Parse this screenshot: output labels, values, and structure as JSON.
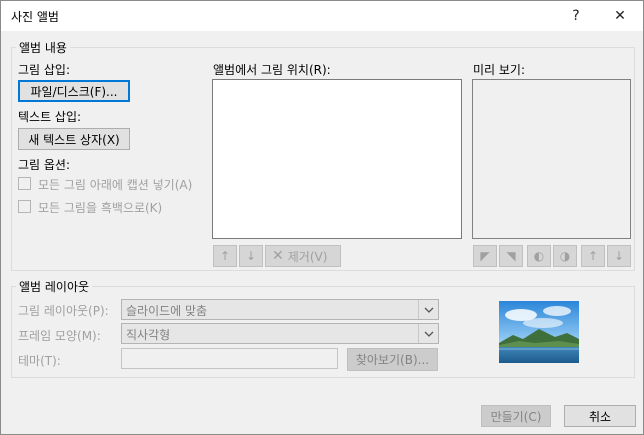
{
  "window": {
    "title": "사진 앨범",
    "help": "?",
    "close": "✕"
  },
  "album_content": {
    "group_label": "앨범 내용",
    "insert_picture_label": "그림 삽입:",
    "file_disk_button": "파일/디스크(F)...",
    "insert_text_label": "텍스트 삽입:",
    "new_textbox_button": "새 텍스트 상자(X)",
    "picture_options_label": "그림 옵션:",
    "caption_checkbox": "모든 그림 아래에 캡션 넣기(A)",
    "bw_checkbox": "모든 그림을 흑백으로(K)",
    "pictures_in_album_label": "앨범에서 그림 위치(R):",
    "remove_button": "제거(V)",
    "preview_label": "미리 보기:"
  },
  "album_layout": {
    "group_label": "앨범 레이아웃",
    "picture_layout_label": "그림 레이아웃(P):",
    "picture_layout_value": "슬라이드에 맞춤",
    "frame_shape_label": "프레임 모양(M):",
    "frame_shape_value": "직사각형",
    "theme_label": "테마(T):",
    "theme_value": "",
    "browse_button": "찾아보기(B)..."
  },
  "footer": {
    "create_button": "만들기(C)",
    "cancel_button": "취소"
  },
  "icons": {
    "move_up": "up-arrow-icon",
    "move_down": "down-arrow-icon",
    "remove": "x-remove-icon",
    "rotate_left": "rotate-left-icon",
    "rotate_right": "rotate-right-icon",
    "contrast_up": "contrast-increase-icon",
    "contrast_down": "contrast-decrease-icon",
    "brightness_up": "brightness-increase-icon",
    "brightness_down": "brightness-decrease-icon"
  },
  "colors": {
    "accent": "#0078d7",
    "dialog_bg": "#f0f0f0"
  }
}
